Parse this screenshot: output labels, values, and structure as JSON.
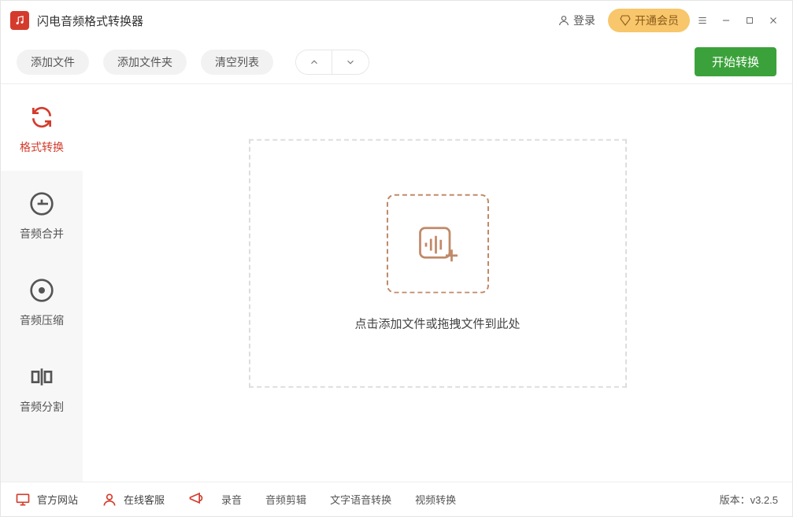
{
  "titlebar": {
    "app_title": "闪电音频格式转换器",
    "login_label": "登录",
    "vip_label": "开通会员"
  },
  "toolbar": {
    "add_file_label": "添加文件",
    "add_folder_label": "添加文件夹",
    "clear_list_label": "清空列表",
    "start_label": "开始转换"
  },
  "sidebar": {
    "items": [
      {
        "label": "格式转换"
      },
      {
        "label": "音频合并"
      },
      {
        "label": "音频压缩"
      },
      {
        "label": "音频分割"
      }
    ]
  },
  "main": {
    "drop_text": "点击添加文件或拖拽文件到此处"
  },
  "footer": {
    "website_label": "官方网站",
    "support_label": "在线客服",
    "links": [
      {
        "label": "录音"
      },
      {
        "label": "音频剪辑"
      },
      {
        "label": "文字语音转换"
      },
      {
        "label": "视频转换"
      }
    ],
    "version_prefix": "版本：",
    "version_value": "v3.2.5"
  }
}
